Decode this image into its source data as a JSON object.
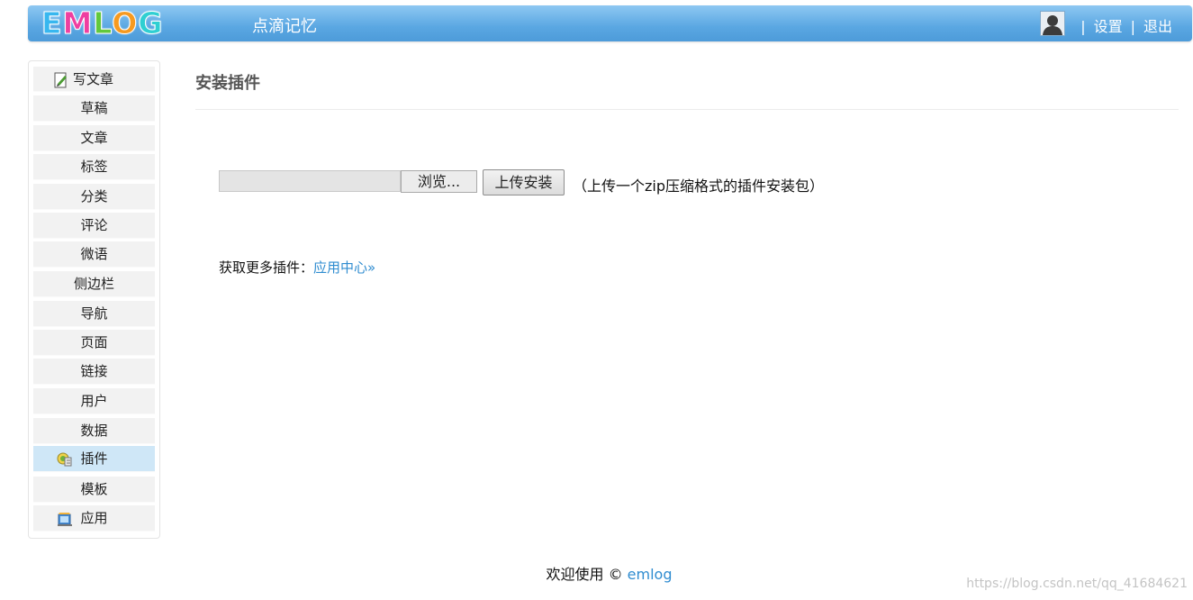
{
  "header": {
    "logo_letters": [
      "E",
      "M",
      "L",
      "O",
      "G"
    ],
    "logo_colors": [
      "#37b7ef",
      "#ef3fa0",
      "#62c83c",
      "#f69a20",
      "#2fcfd2"
    ],
    "site_name": "点滴记忆",
    "avatar_icon": "user-avatar-icon",
    "separator": "|",
    "settings_label": "设置",
    "logout_label": "退出"
  },
  "sidebar": {
    "items": [
      {
        "label": "写文章",
        "icon": "edit-icon"
      },
      {
        "label": "草稿"
      },
      {
        "label": "文章"
      },
      {
        "label": "标签"
      },
      {
        "label": "分类"
      },
      {
        "label": "评论"
      },
      {
        "label": "微语"
      },
      {
        "label": "侧边栏"
      },
      {
        "label": "导航"
      },
      {
        "label": "页面"
      },
      {
        "label": "链接"
      },
      {
        "label": "用户"
      },
      {
        "label": "数据"
      },
      {
        "label": "插件",
        "icon": "plugin-icon",
        "active": true
      },
      {
        "label": "模板"
      },
      {
        "label": "应用",
        "icon": "app-store-icon"
      }
    ]
  },
  "main": {
    "title": "安装插件",
    "file_input_value": "",
    "browse_label": "浏览...",
    "upload_label": "上传安装",
    "upload_hint": "（上传一个zip压缩格式的插件安装包）",
    "more_prefix": "获取更多插件：",
    "more_link": "应用中心»"
  },
  "footer": {
    "prefix": "欢迎使用 © ",
    "link": "emlog"
  },
  "watermark": "https://blog.csdn.net/qq_41684621",
  "colors": {
    "header_gradient_top": "#8ec8f2",
    "header_gradient_bottom": "#4d9bd9",
    "link_blue": "#2f8cd0",
    "active_item": "#cfe7f7"
  }
}
